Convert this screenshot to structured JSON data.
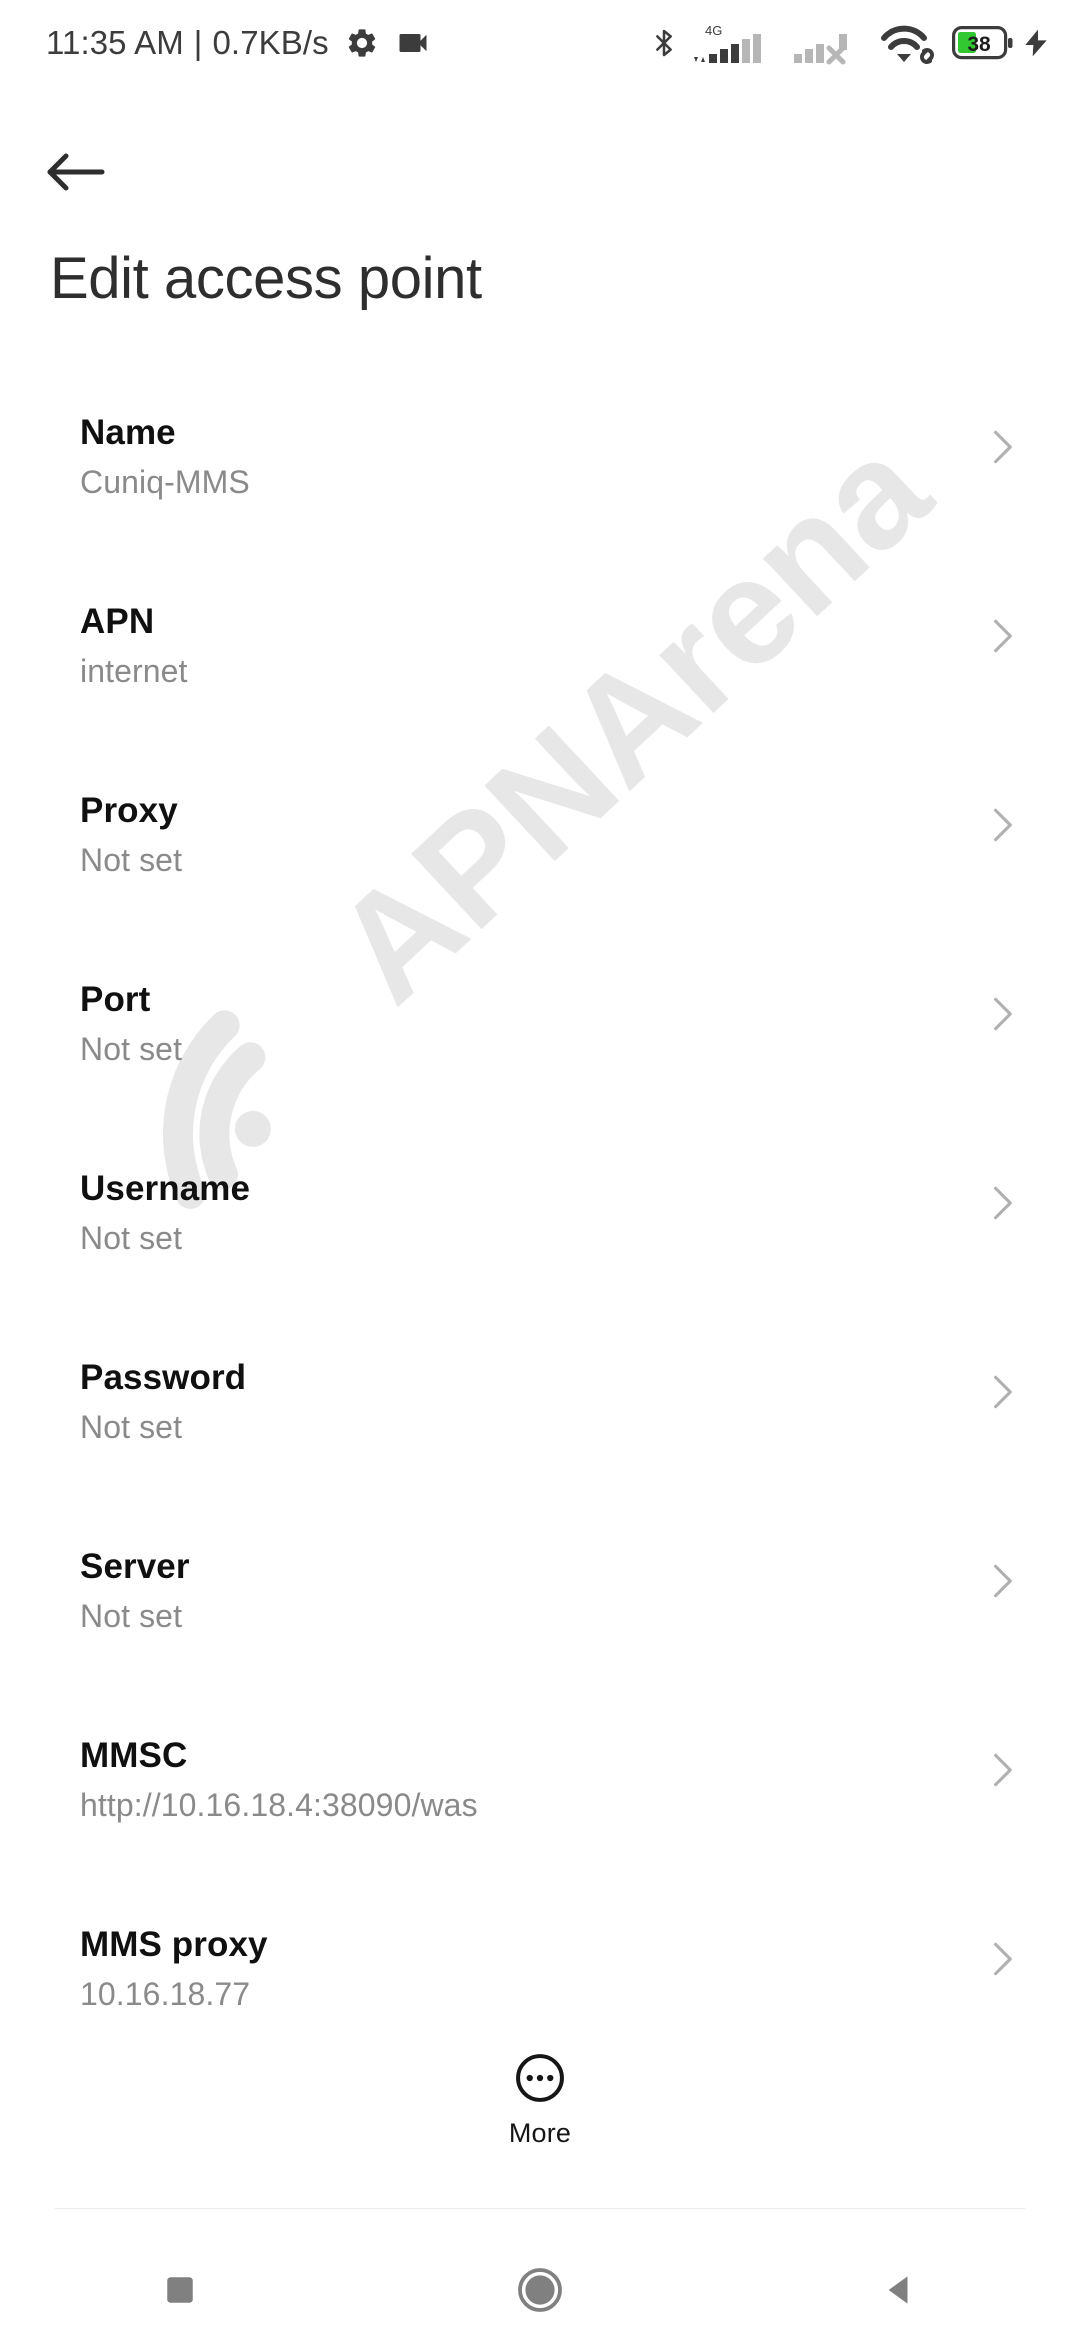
{
  "status_bar": {
    "time": "11:35 AM",
    "separator": "|",
    "network_speed": "0.7KB/s",
    "icons_left": [
      "gear-icon",
      "video-camera-icon"
    ],
    "icons_right": [
      "bluetooth-icon",
      "signal-4g-icon",
      "signal-sim2-no-service-icon",
      "wifi-link-icon",
      "battery-icon",
      "charging-bolt-icon"
    ],
    "network_type": "4G",
    "battery_level": "38",
    "battery_color": "#32c832"
  },
  "header": {
    "back_icon": "arrow-left-icon",
    "title": "Edit access point"
  },
  "settings": {
    "rows": [
      {
        "title": "Name",
        "value": "Cuniq-MMS"
      },
      {
        "title": "APN",
        "value": "internet"
      },
      {
        "title": "Proxy",
        "value": "Not set"
      },
      {
        "title": "Port",
        "value": "Not set"
      },
      {
        "title": "Username",
        "value": "Not set"
      },
      {
        "title": "Password",
        "value": "Not set"
      },
      {
        "title": "Server",
        "value": "Not set"
      },
      {
        "title": "MMSC",
        "value": "http://10.16.18.4:38090/was"
      },
      {
        "title": "MMS proxy",
        "value": "10.16.18.77"
      }
    ],
    "chevron_icon": "chevron-right-icon",
    "chevron_color": "#b0b0b0"
  },
  "more_button": {
    "label": "More",
    "icon": "more-circle-icon"
  },
  "nav_bar": {
    "recents_icon": "square-recents-icon",
    "home_icon": "circle-home-icon",
    "back_icon": "triangle-back-icon",
    "color": "#808080"
  },
  "watermark": {
    "text": "APNArena",
    "logo": "wifi-arcs-icon",
    "color": "#e8e8e8"
  },
  "colors": {
    "background": "#ffffff",
    "title_text": "#2e2e2e",
    "row_title": "#101010",
    "row_value": "#8a8a8a",
    "divider": "#ececec"
  }
}
